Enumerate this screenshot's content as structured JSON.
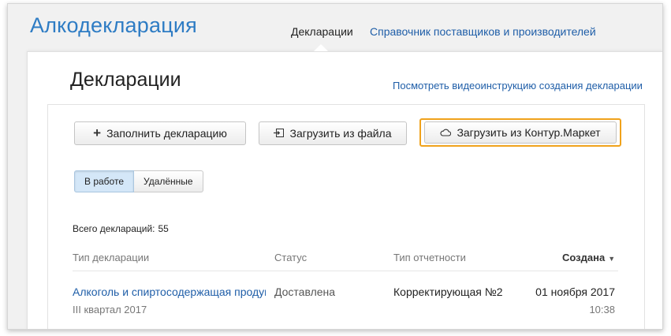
{
  "header": {
    "logo": "Алкодекларация",
    "nav_active": "Декларации",
    "nav_link": "Справочник поставщиков и производителей"
  },
  "page": {
    "title": "Декларации",
    "video_link": "Посмотреть видеоинструкцию создания декларации"
  },
  "toolbar": {
    "fill_label": "Заполнить декларацию",
    "file_label": "Загрузить из файла",
    "market_label": "Загрузить из Контур.Маркет",
    "fill_icon": "plus-icon",
    "file_icon": "import-file-icon",
    "market_icon": "cloud-icon",
    "highlight_color": "#f0a21b"
  },
  "filter": {
    "active": "В работе",
    "inactive": "Удалённые"
  },
  "summary": {
    "total_label": "Всего деклараций:",
    "total_count": "55"
  },
  "table": {
    "headers": {
      "type": "Тип декларации",
      "status": "Статус",
      "report": "Тип отчетности",
      "created": "Создана"
    },
    "rows": [
      {
        "type": "Алкоголь и спиртосодержащая продукция",
        "period": "III квартал 2017",
        "status": "Доставлена",
        "report": "Корректирующая №2",
        "date": "01 ноября 2017",
        "time": "10:38"
      }
    ]
  },
  "colors": {
    "brand": "#2e7cc4",
    "link": "#1f5ea8"
  }
}
